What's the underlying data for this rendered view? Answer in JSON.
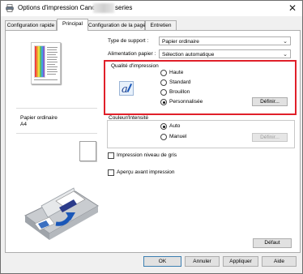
{
  "window": {
    "title_prefix": "Options d'impression Canon",
    "title_suffix": "series",
    "close_glyph": "✕",
    "icon": "printer-icon"
  },
  "tabs": [
    {
      "label": "Configuration rapide",
      "active": false
    },
    {
      "label": "Principal",
      "active": true
    },
    {
      "label": "Configuration de la page",
      "active": false
    },
    {
      "label": "Entretien",
      "active": false
    }
  ],
  "left": {
    "media_label": "Papier ordinaire",
    "size_label": "A4"
  },
  "settings": {
    "media_type_label": "Type de support :",
    "media_type_value": "Papier ordinaire",
    "paper_source_label": "Alimentation papier :",
    "paper_source_value": "Sélection automatique",
    "quality_group_label": "Qualité d'impression",
    "quality_options": [
      "Haute",
      "Standard",
      "Brouillon",
      "Personnalisée"
    ],
    "quality_selected": "Personnalisée",
    "quality_define_button": "Définir...",
    "color_group_label": "Couleur/Intensité",
    "color_options": [
      "Auto",
      "Manuel"
    ],
    "color_selected": "Auto",
    "color_define_button": "Définir...",
    "grayscale_label": "Impression niveau de gris",
    "grayscale_checked": false,
    "preview_label": "Aperçu avant impression",
    "preview_checked": false,
    "default_button": "Défaut"
  },
  "footer": {
    "ok": "OK",
    "cancel": "Annuler",
    "apply": "Appliquer",
    "help": "Aide"
  },
  "colors": {
    "highlight_border": "#e0202a",
    "accent": "#3c7fb1"
  }
}
